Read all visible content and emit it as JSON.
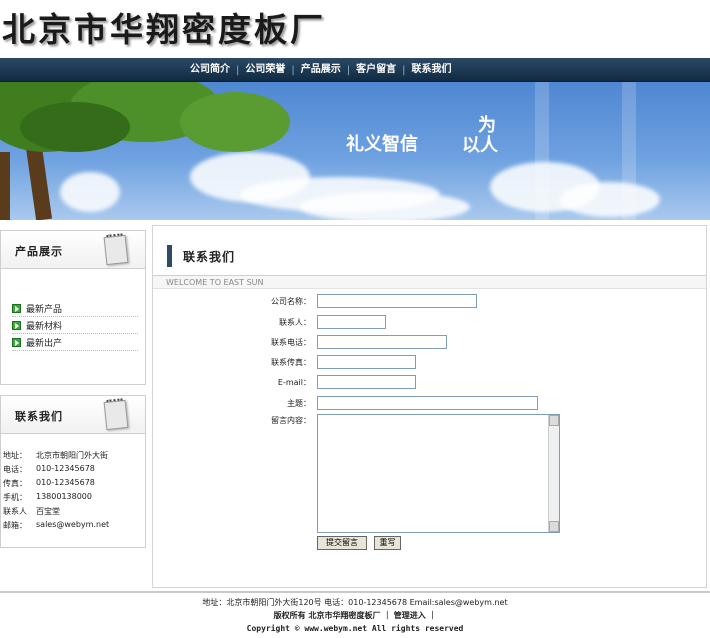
{
  "site": {
    "name": "北京市华翔密度板厂"
  },
  "nav": [
    "公司简介",
    "公司荣誉",
    "产品展示",
    "客户留言",
    "联系我们"
  ],
  "banner": {
    "slogan_a": "礼义智信",
    "slogan_b_top": "为",
    "slogan_b_bottom": "以人"
  },
  "sidebar": {
    "products_title": "产品展示",
    "products": [
      "最新产品",
      "最新材料",
      "最新出产"
    ],
    "contact_title": "联系我们",
    "contact": [
      {
        "key": "地址：",
        "value": "北京市朝阳门外大街"
      },
      {
        "key": "电话：",
        "value": "010-12345678"
      },
      {
        "key": "传真：",
        "value": "010-12345678"
      },
      {
        "key": "手机：",
        "value": "13800138000"
      },
      {
        "key": "联系人",
        "value": "百宝堂"
      },
      {
        "key": "邮箱：",
        "value": "sales@webym.net"
      }
    ]
  },
  "main": {
    "title": "联系我们",
    "welcome": "WELCOME TO EAST SUN",
    "form": {
      "company_label": "公司名称：",
      "contact_label": "联系人：",
      "phone_label": "联系电话：",
      "fax_label": "联系传真：",
      "email_label": "E-mail：",
      "subject_label": "主题：",
      "message_label": "留言内容：",
      "submit": "提交留言",
      "reset": "重写"
    }
  },
  "footer": {
    "address": "地址：北京市朝阳门外大街120号  电话：010-12345678 Email:sales@webym.net",
    "copyright_prefix": "版权所有 北京市华翔密度板厂 ｜",
    "admin_link": "管理进入",
    "copyright_suffix": "｜",
    "copyright_line": "Copyright © www.webym.net All rights reserved"
  },
  "colors": {
    "nav_bg": "#1c3852",
    "accent_bar": "#2e4a66",
    "sky": "#5e95d9"
  }
}
